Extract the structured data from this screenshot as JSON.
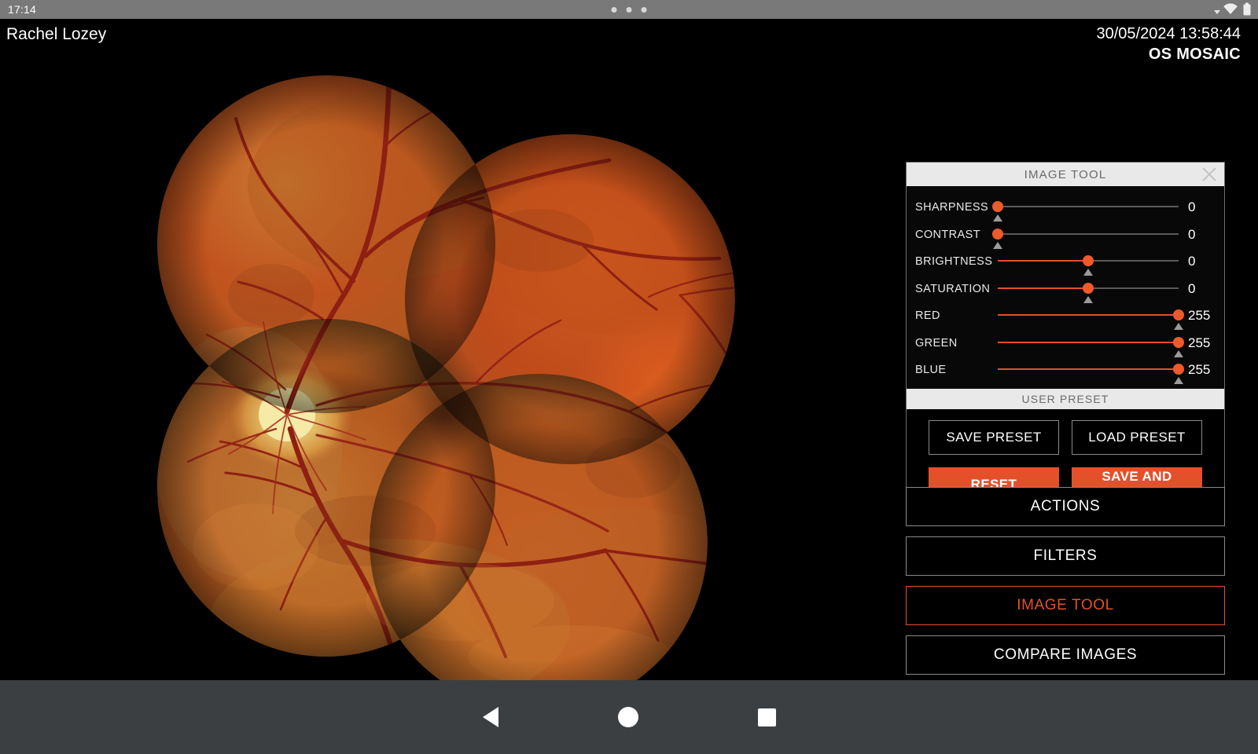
{
  "statusbar": {
    "time": "17:14",
    "icons": [
      "dropdown-caret-icon",
      "wifi-icon",
      "battery-icon"
    ],
    "dots": 3
  },
  "header": {
    "patient_name": "Rachel Lozey",
    "study_datetime": "30/05/2024 13:58:44",
    "eye_label": "OS MOSAIC"
  },
  "viewer": {
    "modality": "fundus-mosaic",
    "description": "Color fundus photograph mosaic of left eye, four overlapping circular captures"
  },
  "image_tool": {
    "title": "IMAGE TOOL",
    "close_icon": "close-icon",
    "sliders": [
      {
        "label": "SHARPNESS",
        "value": "0",
        "pct": 0
      },
      {
        "label": "CONTRAST",
        "value": "0",
        "pct": 0
      },
      {
        "label": "BRIGHTNESS",
        "value": "0",
        "pct": 50
      },
      {
        "label": "SATURATION",
        "value": "0",
        "pct": 50
      },
      {
        "label": "RED",
        "value": "255",
        "pct": 100
      },
      {
        "label": "GREEN",
        "value": "255",
        "pct": 100
      },
      {
        "label": "BLUE",
        "value": "255",
        "pct": 100
      }
    ],
    "user_preset": {
      "title": "USER PRESET",
      "save_preset": "SAVE PRESET",
      "load_preset": "LOAD PRESET",
      "reset": "RESET",
      "save_and_synchronize": "SAVE AND SYNCHRONIZE"
    }
  },
  "menu": {
    "items": [
      {
        "label": "ACTIONS",
        "active": false
      },
      {
        "label": "FILTERS",
        "active": false
      },
      {
        "label": "IMAGE TOOL",
        "active": true
      },
      {
        "label": "COMPARE IMAGES",
        "active": false
      }
    ]
  },
  "navbar": {
    "back": "back-icon",
    "home": "home-icon",
    "recents": "recents-icon"
  },
  "colors": {
    "accent": "#e4502a",
    "panel_header_bg": "#e9e9e9",
    "background": "#000000",
    "statusbar_bg": "#797979",
    "navbar_bg": "#3c3f41"
  }
}
